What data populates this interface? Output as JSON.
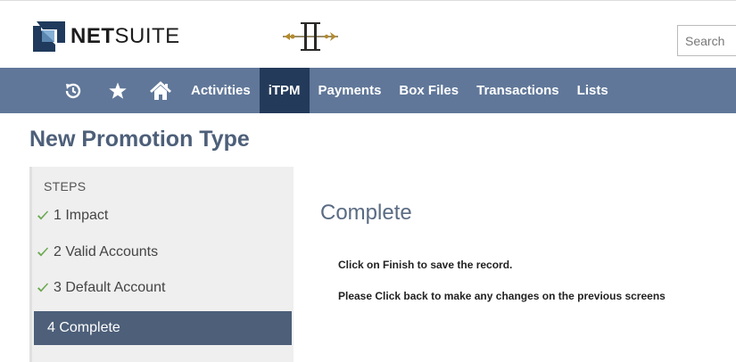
{
  "brand": {
    "logo_text_bold": "NET",
    "logo_text_regular": "SUITE"
  },
  "search": {
    "placeholder": "Search"
  },
  "nav": {
    "icons": [
      "recent-icon",
      "star-icon",
      "home-icon"
    ],
    "items": [
      {
        "label": "Activities",
        "active": false
      },
      {
        "label": "iTPM",
        "active": true
      },
      {
        "label": "Payments",
        "active": false
      },
      {
        "label": "Box Files",
        "active": false
      },
      {
        "label": "Transactions",
        "active": false
      },
      {
        "label": "Lists",
        "active": false
      }
    ]
  },
  "page": {
    "title": "New Promotion Type"
  },
  "steps": {
    "header": "STEPS",
    "items": [
      {
        "label": "1 Impact",
        "done": true
      },
      {
        "label": "2 Valid Accounts",
        "done": true
      },
      {
        "label": "3 Default Account",
        "done": true
      },
      {
        "label": "4 Complete",
        "done": false,
        "current": true
      }
    ]
  },
  "content": {
    "title": "Complete",
    "message1": "Click on Finish to save the record.",
    "message2": "Please Click back to make any changes on the previous screens"
  },
  "colors": {
    "nav_bg": "#607799",
    "nav_active": "#243a5a",
    "accent": "#4d5f79",
    "check_green": "#6aa84f"
  }
}
